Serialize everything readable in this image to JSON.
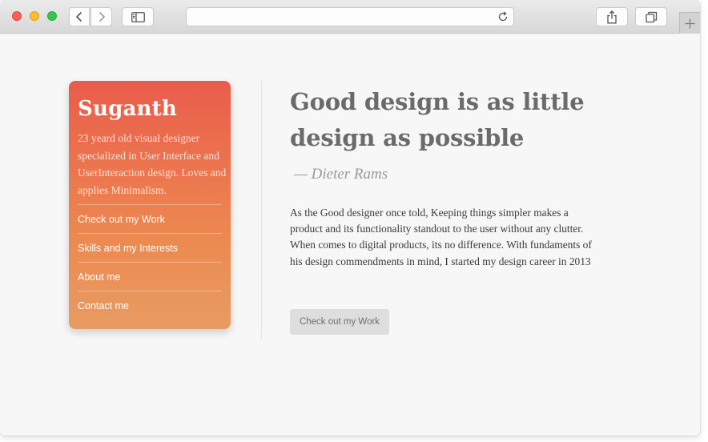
{
  "browser": {
    "url": "",
    "icons": {
      "back": "chevron-left-icon",
      "forward": "chevron-right-icon",
      "sidebar": "sidebar-icon",
      "reload": "reload-icon",
      "share": "share-icon",
      "tabs": "tabs-overview-icon",
      "new_tab": "plus-icon"
    }
  },
  "profile": {
    "name": "Suganth",
    "bio": "23 yeard old visual designer specialized in User Interface and UserInteraction design. Loves and applies Minimalism.",
    "menu": [
      {
        "label": "Check out my Work"
      },
      {
        "label": "Skills and my Interests"
      },
      {
        "label": "About me"
      },
      {
        "label": "Contact me"
      }
    ],
    "gradient": [
      "#ea5c4b",
      "#ec8a50",
      "#e79c63"
    ]
  },
  "main": {
    "quote": "Good design is as little design as possible",
    "attribution": "— Dieter Rams",
    "body": "As the Good designer once told, Keeping things simpler makes a product and its functionality standout to the user without any clutter. When comes to digital products, its no difference. With fundaments of his design commendments in mind, I started my design career in 2013",
    "cta_label": "Check out my Work"
  }
}
